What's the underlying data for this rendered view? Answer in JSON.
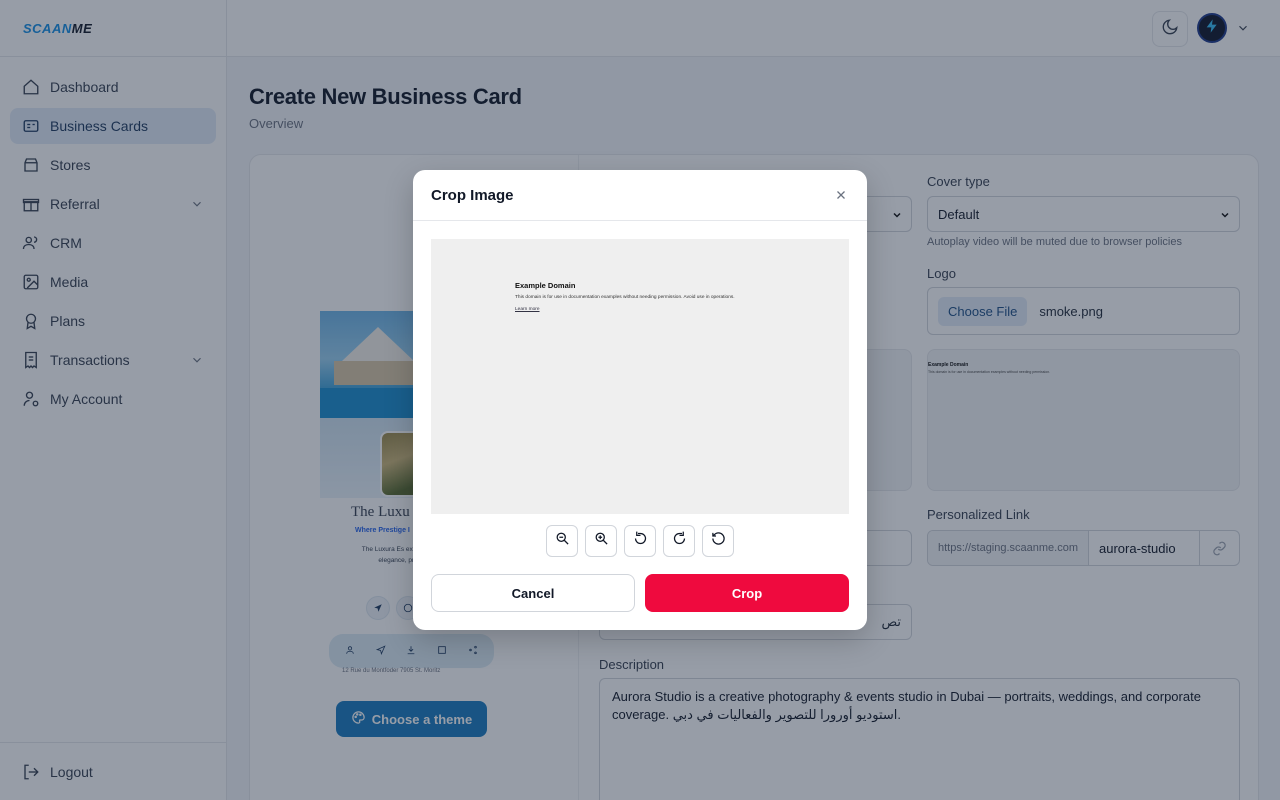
{
  "brand": {
    "logo_prefix": "SCAAN",
    "logo_suffix": "ME"
  },
  "sidebar": {
    "items": [
      {
        "label": "Dashboard",
        "icon": "home-icon"
      },
      {
        "label": "Business Cards",
        "icon": "id-card-icon",
        "active": true
      },
      {
        "label": "Stores",
        "icon": "store-icon"
      },
      {
        "label": "Referral",
        "icon": "gift-icon",
        "expandable": true
      },
      {
        "label": "CRM",
        "icon": "users-icon"
      },
      {
        "label": "Media",
        "icon": "image-icon"
      },
      {
        "label": "Plans",
        "icon": "award-icon"
      },
      {
        "label": "Transactions",
        "icon": "receipt-icon",
        "expandable": true
      },
      {
        "label": "My Account",
        "icon": "user-cog-icon"
      }
    ],
    "logout_label": "Logout"
  },
  "page": {
    "title": "Create New Business Card",
    "subtitle": "Overview"
  },
  "preview": {
    "card_name": "The Luxu",
    "card_tagline": "Where Prestige I",
    "card_desc": "The Luxura Es exclusive seasid elegance, privac me",
    "card_address": "12 Rue du Montfoder 7905 St. Moritz",
    "choose_theme_label": "Choose a theme"
  },
  "form": {
    "cover_type_label": "Cover type",
    "cover_type_value": "Default",
    "cover_type_hint": "Autoplay video will be muted due to browser policies",
    "logo_label": "Logo",
    "choose_file_label": "Choose File",
    "file_name": "smoke.png",
    "personalized_link_label": "Personalized Link",
    "link_prefix": "https://staging.scaanme.com",
    "link_slug": "aurora-studio",
    "partial_input_text": "تص",
    "description_label": "Description",
    "description_value": "Aurora Studio is a creative photography & events studio in Dubai — portraits, weddings, and corporate coverage. استوديو أورورا للتصوير والفعاليات في دبي."
  },
  "tile_preview": {
    "title": "Example Domain",
    "body": "This domain is for use in documentation examples without needing permission."
  },
  "modal": {
    "title": "Crop Image",
    "crop_preview": {
      "title": "Example Domain",
      "body": "This domain is for use in documentation examples without needing permission. Avoid use in operations.",
      "link": "Learn more"
    },
    "tools": [
      "zoom-out-icon",
      "zoom-in-icon",
      "rotate-left-icon",
      "rotate-right-icon",
      "reset-icon"
    ],
    "cancel_label": "Cancel",
    "crop_label": "Crop"
  },
  "colors": {
    "accent": "#1a7bbf",
    "crop_button": "#ef0a3e",
    "active_nav": "#e2ecf8"
  }
}
